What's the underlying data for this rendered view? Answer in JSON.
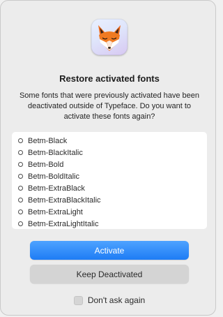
{
  "dialog": {
    "title": "Restore activated fonts",
    "message": "Some fonts that were previously activated have been deactivated outside of Typeface. Do you want to activate these fonts again?",
    "app_icon": "fox-app-icon"
  },
  "font_list": {
    "items": [
      "Betm-Black",
      "Betm-BlackItalic",
      "Betm-Bold",
      "Betm-BoldItalic",
      "Betm-ExtraBlack",
      "Betm-ExtraBlackItalic",
      "Betm-ExtraLight",
      "Betm-ExtraLightItalic"
    ]
  },
  "buttons": {
    "activate_label": "Activate",
    "keep_label": "Keep Deactivated"
  },
  "checkbox": {
    "label": "Don't ask again",
    "checked": false
  },
  "colors": {
    "accent": "#1e7cf5",
    "dialog_bg": "#ececec",
    "list_bg": "#ffffff"
  }
}
